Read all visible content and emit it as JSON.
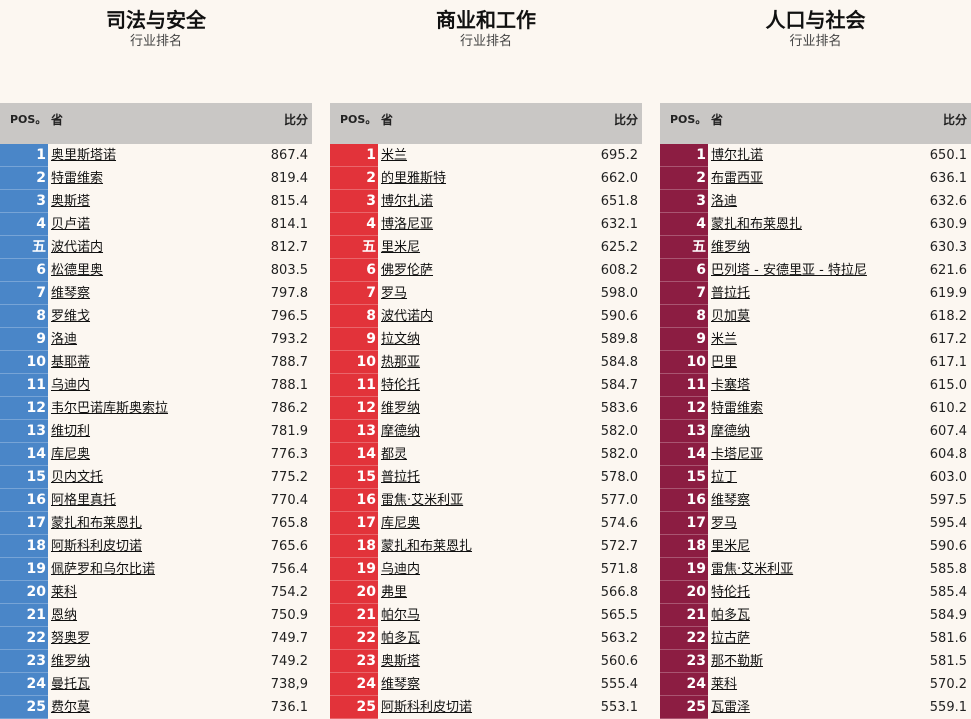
{
  "panels": [
    {
      "title": "司法与安全",
      "subtitle": "行业排名",
      "header": {
        "pos": "POS。",
        "name": "省",
        "score": "比分"
      },
      "color": "#4a86c8",
      "rows": [
        {
          "rank": "1",
          "name": "奥里斯塔诺",
          "score": "867.4"
        },
        {
          "rank": "2",
          "name": "特雷维索",
          "score": "819.4"
        },
        {
          "rank": "3",
          "name": "奥斯塔",
          "score": "815.4"
        },
        {
          "rank": "4",
          "name": "贝卢诺",
          "score": "814.1"
        },
        {
          "rank": "五",
          "name": "波代诺内",
          "score": "812.7"
        },
        {
          "rank": "6",
          "name": "松德里奥",
          "score": "803.5"
        },
        {
          "rank": "7",
          "name": "维琴察",
          "score": "797.8"
        },
        {
          "rank": "8",
          "name": "罗维戈",
          "score": "796.5"
        },
        {
          "rank": "9",
          "name": "洛迪",
          "score": "793.2"
        },
        {
          "rank": "10",
          "name": "基耶蒂",
          "score": "788.7"
        },
        {
          "rank": "11",
          "name": "乌迪内",
          "score": "788.1"
        },
        {
          "rank": "12",
          "name": "韦尔巴诺库斯奥索拉",
          "score": "786.2"
        },
        {
          "rank": "13",
          "name": "维切利",
          "score": "781.9"
        },
        {
          "rank": "14",
          "name": "库尼奥",
          "score": "776.3"
        },
        {
          "rank": "15",
          "name": "贝内文托",
          "score": "775.2"
        },
        {
          "rank": "16",
          "name": "阿格里真托",
          "score": "770.4"
        },
        {
          "rank": "17",
          "name": "蒙扎和布莱恩扎",
          "score": "765.8"
        },
        {
          "rank": "18",
          "name": "阿斯科利皮切诺",
          "score": "765.6"
        },
        {
          "rank": "19",
          "name": "佩萨罗和乌尔比诺",
          "score": "756.4"
        },
        {
          "rank": "20",
          "name": "莱科",
          "score": "754.2"
        },
        {
          "rank": "21",
          "name": "恩纳",
          "score": "750.9"
        },
        {
          "rank": "22",
          "name": "努奥罗",
          "score": "749.7"
        },
        {
          "rank": "23",
          "name": "维罗纳",
          "score": "749.2"
        },
        {
          "rank": "24",
          "name": "曼托瓦",
          "score": "738,9"
        },
        {
          "rank": "25",
          "name": "费尔莫",
          "score": "736.1"
        }
      ]
    },
    {
      "title": "商业和工作",
      "subtitle": "行业排名",
      "header": {
        "pos": "POS。",
        "name": "省",
        "score": "比分"
      },
      "color": "#e2333a",
      "rows": [
        {
          "rank": "1",
          "name": "米兰",
          "score": "695.2"
        },
        {
          "rank": "2",
          "name": "的里雅斯特",
          "score": "662.0"
        },
        {
          "rank": "3",
          "name": "博尔扎诺",
          "score": "651.8"
        },
        {
          "rank": "4",
          "name": "博洛尼亚",
          "score": "632.1"
        },
        {
          "rank": "五",
          "name": "里米尼",
          "score": "625.2"
        },
        {
          "rank": "6",
          "name": "佛罗伦萨",
          "score": "608.2"
        },
        {
          "rank": "7",
          "name": "罗马",
          "score": "598.0"
        },
        {
          "rank": "8",
          "name": "波代诺内",
          "score": "590.6"
        },
        {
          "rank": "9",
          "name": "拉文纳",
          "score": "589.8"
        },
        {
          "rank": "10",
          "name": "热那亚",
          "score": "584.8"
        },
        {
          "rank": "11",
          "name": "特伦托",
          "score": "584.7"
        },
        {
          "rank": "12",
          "name": "维罗纳",
          "score": "583.6"
        },
        {
          "rank": "13",
          "name": "摩德纳",
          "score": "582.0"
        },
        {
          "rank": "14",
          "name": "都灵",
          "score": "582.0"
        },
        {
          "rank": "15",
          "name": "普拉托",
          "score": "578.0"
        },
        {
          "rank": "16",
          "name": "雷焦·艾米利亚",
          "score": "577.0"
        },
        {
          "rank": "17",
          "name": "库尼奥",
          "score": "574.6"
        },
        {
          "rank": "18",
          "name": "蒙扎和布莱恩扎",
          "score": "572.7"
        },
        {
          "rank": "19",
          "name": "乌迪内",
          "score": "571.8"
        },
        {
          "rank": "20",
          "name": "弗里",
          "score": "566.8"
        },
        {
          "rank": "21",
          "name": "帕尔马",
          "score": "565.5"
        },
        {
          "rank": "22",
          "name": "帕多瓦",
          "score": "563.2"
        },
        {
          "rank": "23",
          "name": "奥斯塔",
          "score": "560.6"
        },
        {
          "rank": "24",
          "name": "维琴察",
          "score": "555.4"
        },
        {
          "rank": "25",
          "name": "阿斯科利皮切诺",
          "score": "553.1"
        }
      ]
    },
    {
      "title": "人口与社会",
      "subtitle": "行业排名",
      "header": {
        "pos": "POS。",
        "name": "省",
        "score": "比分"
      },
      "color": "#8c1d42",
      "rows": [
        {
          "rank": "1",
          "name": "博尔扎诺",
          "score": "650.1"
        },
        {
          "rank": "2",
          "name": "布雷西亚",
          "score": "636.1"
        },
        {
          "rank": "3",
          "name": "洛迪",
          "score": "632.6"
        },
        {
          "rank": "4",
          "name": "蒙扎和布莱恩扎",
          "score": "630.9"
        },
        {
          "rank": "五",
          "name": "维罗纳",
          "score": "630.3"
        },
        {
          "rank": "6",
          "name": "巴列塔 - 安德里亚 - 特拉尼",
          "score": "621.6"
        },
        {
          "rank": "7",
          "name": "普拉托",
          "score": "619.9"
        },
        {
          "rank": "8",
          "name": "贝加莫",
          "score": "618.2"
        },
        {
          "rank": "9",
          "name": "米兰",
          "score": "617.2"
        },
        {
          "rank": "10",
          "name": "巴里",
          "score": "617.1"
        },
        {
          "rank": "11",
          "name": "卡塞塔",
          "score": "615.0"
        },
        {
          "rank": "12",
          "name": "特雷维索",
          "score": "610.2"
        },
        {
          "rank": "13",
          "name": "摩德纳",
          "score": "607.4"
        },
        {
          "rank": "14",
          "name": "卡塔尼亚",
          "score": "604.8"
        },
        {
          "rank": "15",
          "name": "拉丁",
          "score": "603.0"
        },
        {
          "rank": "16",
          "name": "维琴察",
          "score": "597.5"
        },
        {
          "rank": "17",
          "name": "罗马",
          "score": "595.4"
        },
        {
          "rank": "18",
          "name": "里米尼",
          "score": "590.6"
        },
        {
          "rank": "19",
          "name": "雷焦·艾米利亚",
          "score": "585.8"
        },
        {
          "rank": "20",
          "name": "特伦托",
          "score": "585.4"
        },
        {
          "rank": "21",
          "name": "帕多瓦",
          "score": "584.9"
        },
        {
          "rank": "22",
          "name": "拉古萨",
          "score": "581.6"
        },
        {
          "rank": "23",
          "name": "那不勒斯",
          "score": "581.5"
        },
        {
          "rank": "24",
          "name": "莱科",
          "score": "570.2"
        },
        {
          "rank": "25",
          "name": "瓦雷泽",
          "score": "559.1"
        }
      ]
    }
  ]
}
